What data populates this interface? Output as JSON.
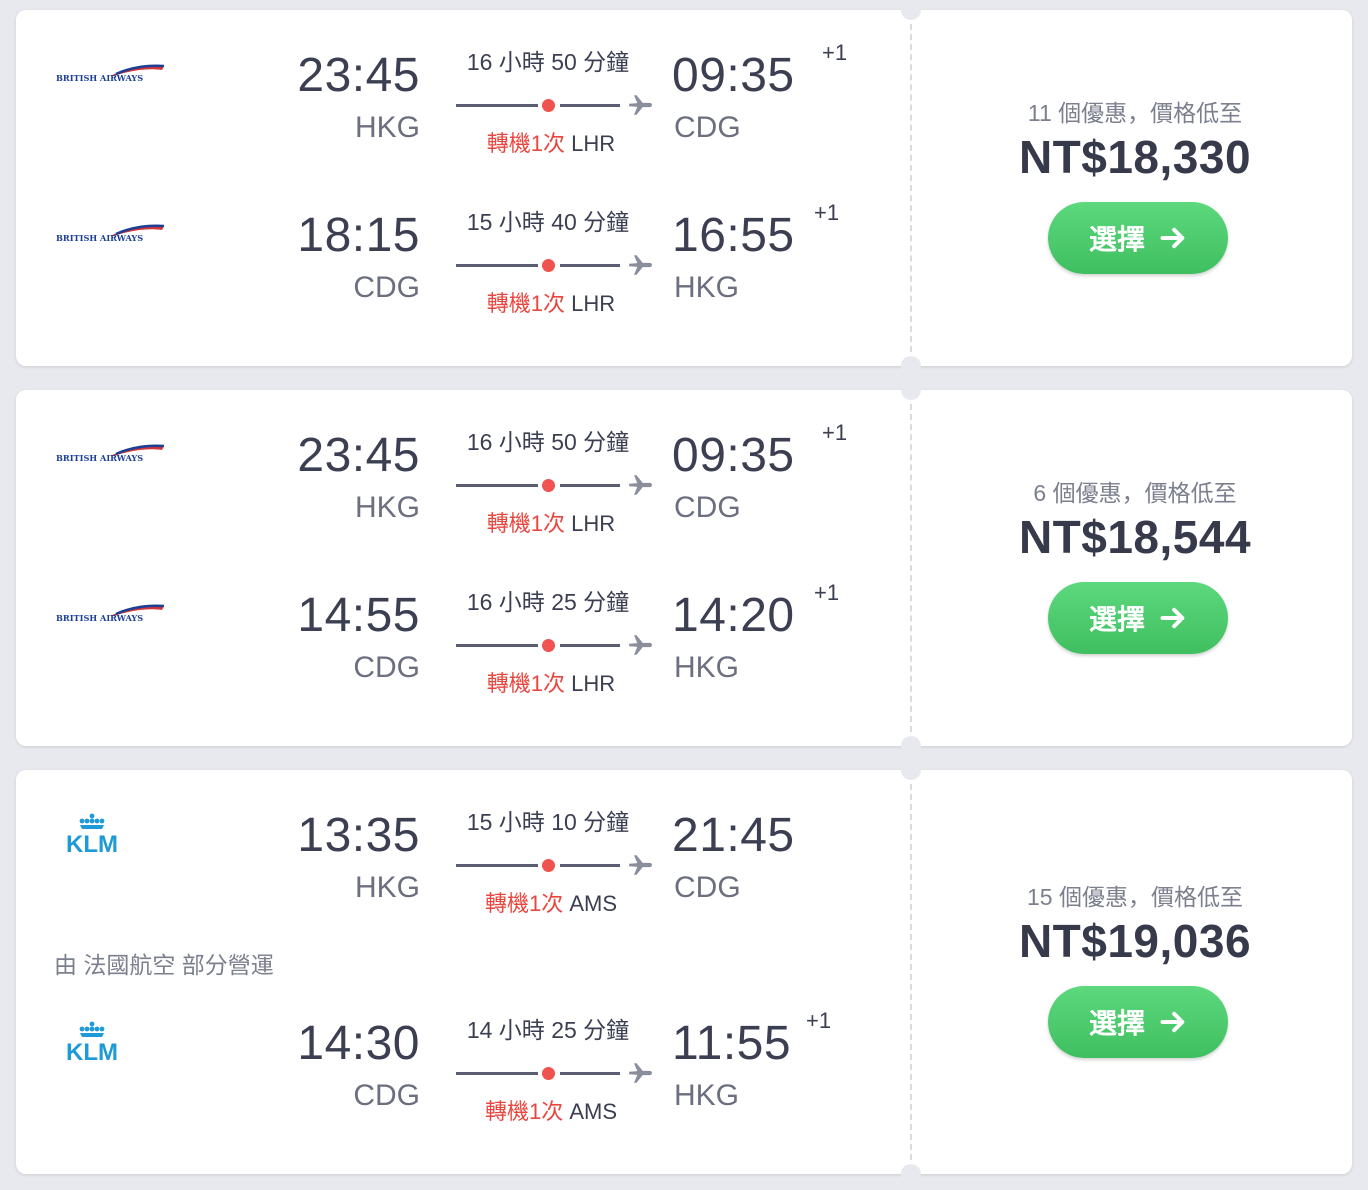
{
  "colors": {
    "accent_green": "#4bc96b",
    "stop_red": "#e9463f",
    "text_dark": "#3b3f51"
  },
  "airlines": {
    "ba": {
      "logo_text": "BRITISH AIRWAYS"
    },
    "klm": {
      "logo_text": "KLM"
    }
  },
  "results": [
    {
      "legs": [
        {
          "airline": "ba",
          "dep_time": "23:45",
          "dep_airport": "HKG",
          "duration": "16 小時 50 分鐘",
          "stop_label": "轉機1次",
          "stop_airport": "LHR",
          "arr_time": "09:35",
          "arr_day": "+1",
          "arr_airport": "CDG"
        },
        {
          "airline": "ba",
          "dep_time": "18:15",
          "dep_airport": "CDG",
          "duration": "15 小時 40 分鐘",
          "stop_label": "轉機1次",
          "stop_airport": "LHR",
          "arr_time": "16:55",
          "arr_day": "+1",
          "arr_airport": "HKG"
        }
      ],
      "deals": "11 個優惠，價格低至",
      "price": "NT$18,330",
      "button": "選擇"
    },
    {
      "legs": [
        {
          "airline": "ba",
          "dep_time": "23:45",
          "dep_airport": "HKG",
          "duration": "16 小時 50 分鐘",
          "stop_label": "轉機1次",
          "stop_airport": "LHR",
          "arr_time": "09:35",
          "arr_day": "+1",
          "arr_airport": "CDG"
        },
        {
          "airline": "ba",
          "dep_time": "14:55",
          "dep_airport": "CDG",
          "duration": "16 小時 25 分鐘",
          "stop_label": "轉機1次",
          "stop_airport": "LHR",
          "arr_time": "14:20",
          "arr_day": "+1",
          "arr_airport": "HKG"
        }
      ],
      "deals": "6 個優惠，價格低至",
      "price": "NT$18,544",
      "button": "選擇"
    },
    {
      "legs": [
        {
          "airline": "klm",
          "dep_time": "13:35",
          "dep_airport": "HKG",
          "duration": "15 小時 10 分鐘",
          "stop_label": "轉機1次",
          "stop_airport": "AMS",
          "arr_time": "21:45",
          "arr_day": "",
          "arr_airport": "CDG"
        },
        {
          "airline": "klm",
          "dep_time": "14:30",
          "dep_airport": "CDG",
          "duration": "14 小時 25 分鐘",
          "stop_label": "轉機1次",
          "stop_airport": "AMS",
          "arr_time": "11:55",
          "arr_day": "+1",
          "arr_airport": "HKG"
        }
      ],
      "operated_by": "由 法國航空 部分營運",
      "deals": "15 個優惠，價格低至",
      "price": "NT$19,036",
      "button": "選擇"
    }
  ]
}
